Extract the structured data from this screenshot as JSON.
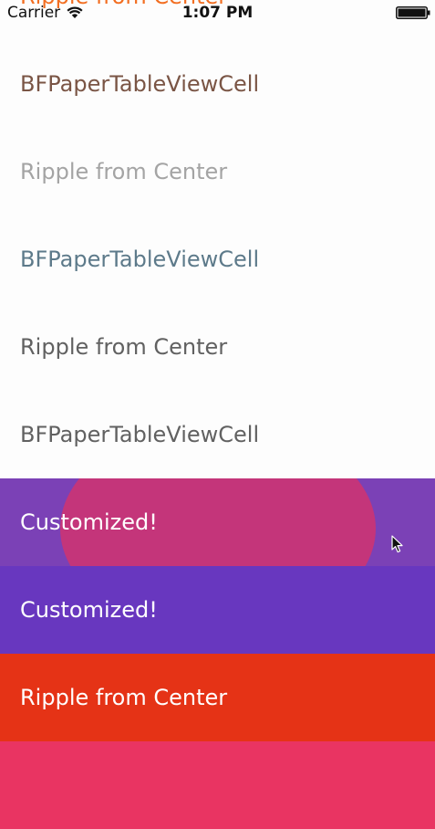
{
  "status_bar": {
    "carrier": "Carrier",
    "time": "1:07 PM",
    "wifi_icon": "wifi-icon",
    "battery_icon": "battery-icon"
  },
  "peek_cell": {
    "label": "Ripple from Center",
    "color": "#f26e21"
  },
  "cells": [
    {
      "label": "BFPaperTableViewCell",
      "text_color": "#7a5545",
      "background": "#fdfdfd"
    },
    {
      "label": "Ripple from Center",
      "text_color": "#a4a4a4",
      "background": "#fdfdfd"
    },
    {
      "label": "BFPaperTableViewCell",
      "text_color": "#5d7a8a",
      "background": "#fdfdfd"
    },
    {
      "label": "Ripple from Center",
      "text_color": "#616161",
      "background": "#fdfdfd"
    },
    {
      "label": "BFPaperTableViewCell",
      "text_color": "#616161",
      "background": "#fdfdfd"
    },
    {
      "label": "Customized!",
      "text_color": "#ffffff",
      "background": "#7b41b6",
      "ripple_color": "#c4357a"
    },
    {
      "label": "Customized!",
      "text_color": "#ffffff",
      "background": "#6837bf"
    },
    {
      "label": "Ripple from Center",
      "text_color": "#ffffff",
      "background": "#e53316"
    },
    {
      "label": "",
      "text_color": "#ffffff",
      "background": "#e93462"
    }
  ],
  "cursor_icon": "mouse-pointer-icon"
}
